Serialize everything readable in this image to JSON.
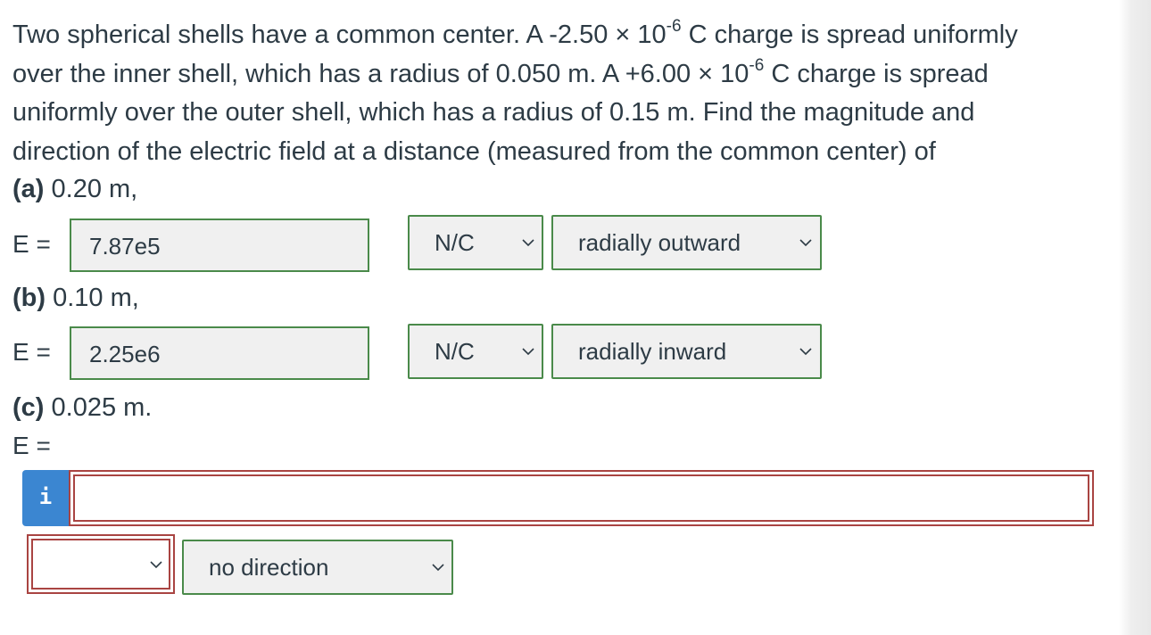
{
  "question": {
    "line1_before": "Two spherical shells have a common center. A -2.50 × 10",
    "line1_exp": "-6",
    "line1_after": " C charge is spread uniformly",
    "line2_before": "over the inner shell, which has a radius of 0.050 m. A +6.00 × 10",
    "line2_exp": "-6",
    "line2_after": " C charge is spread",
    "line3": "uniformly over the outer shell, which has a radius of 0.15 m. Find the magnitude and",
    "line4": "direction of the electric field at a distance (measured from the common center) of"
  },
  "part_a": {
    "label": "(a)",
    "distance": " 0.20 m,",
    "e_label": "E =",
    "value": "7.87e5",
    "unit": "N/C",
    "direction": "radially outward"
  },
  "part_b": {
    "label": "(b)",
    "distance": " 0.10 m,",
    "e_label": "E =",
    "value": "2.25e6",
    "unit": "N/C",
    "direction": "radially inward"
  },
  "part_c": {
    "label": "(c)",
    "distance": " 0.025 m.",
    "e_label": "E =",
    "info_label": "i",
    "value": "",
    "unit": "",
    "direction": "no direction"
  },
  "colors": {
    "correct_border": "#4a8a4a",
    "error_border": "#a94442",
    "info_button": "#3b86d1",
    "text": "#2d3b45"
  }
}
